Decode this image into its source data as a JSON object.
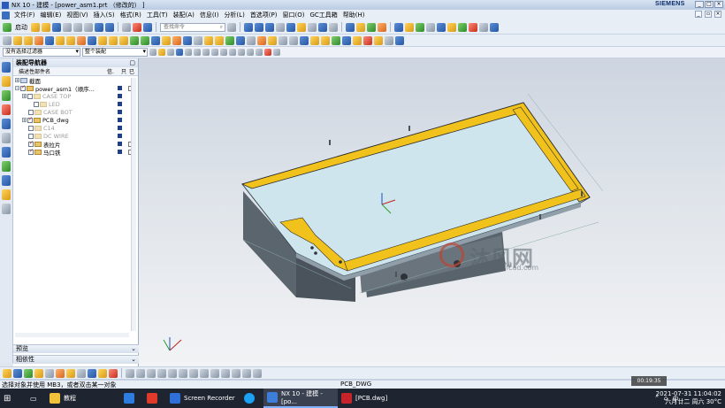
{
  "window": {
    "title": "NX 10 - 建模 - [power_asm1.prt （修改的） ]",
    "brand": "SIEMENS"
  },
  "menu": [
    "文件(F)",
    "编辑(E)",
    "视图(V)",
    "插入(S)",
    "格式(R)",
    "工具(T)",
    "装配(A)",
    "信息(I)",
    "分析(L)",
    "首选项(P)",
    "窗口(O)",
    "GC工具箱",
    "帮助(H)"
  ],
  "toolbar": {
    "start_label": "启动",
    "search_placeholder": "查找命令",
    "filter_value": "没有选择过滤器",
    "assembly_value": "整个装配"
  },
  "navigator": {
    "title": "装配导航器",
    "columns": {
      "name": "描述性部件名",
      "info": "信.",
      "c3": "只",
      "c4": "已"
    },
    "rows": [
      {
        "label": "截面",
        "dim": false
      },
      {
        "label": "power_asm1（顺序...",
        "dim": false
      },
      {
        "label": "CASE TOP",
        "dim": true
      },
      {
        "label": "LED",
        "dim": true
      },
      {
        "label": "CASE BOT",
        "dim": true
      },
      {
        "label": "PCB_dwg",
        "dim": false
      },
      {
        "label": "C14",
        "dim": true
      },
      {
        "label": "DC WIRE",
        "dim": true
      },
      {
        "label": "表拉片",
        "dim": false
      },
      {
        "label": "马口铁",
        "dim": false
      }
    ],
    "preview_label": "预览",
    "dependency_label": "相依性"
  },
  "status": {
    "left": "选择对象并使用 MB3，或者双击某一对象",
    "center": "PCB_DWG"
  },
  "watermark": {
    "cn": "沐风网",
    "url": "www.mfcad.com"
  },
  "overlay_time": "00:19:35",
  "taskbar": {
    "items": [
      {
        "label": "教程",
        "color": "#f0c23a"
      },
      {
        "label": "",
        "color": "#2d7de0"
      },
      {
        "label": "",
        "color": "#e03a2a"
      },
      {
        "label": "Screen Recorder",
        "color": "#2e6fd8"
      },
      {
        "label": "",
        "color": "#1da1f2"
      },
      {
        "label": "NX 10 - 建模 - [po...",
        "color": "#3d7ed8"
      },
      {
        "label": "[PCB.dwg]",
        "color": "#c8222a"
      }
    ],
    "date": "2021-07-31 11:04:02",
    "day": "六月廿二 周六 30°C",
    "ime": "中"
  },
  "colors": {
    "pcb_edge": "#f1c21b",
    "pcb_face": "#cfe6ee",
    "case_body": "#5d6770"
  }
}
